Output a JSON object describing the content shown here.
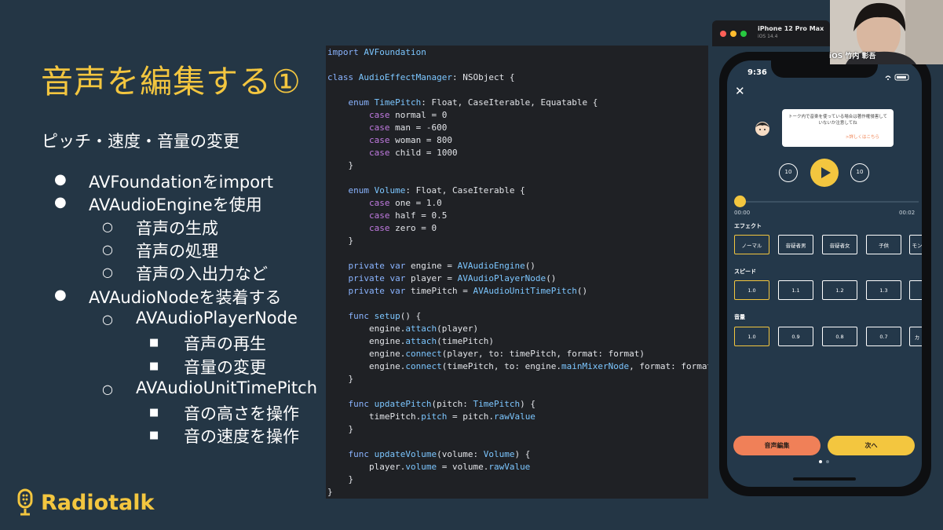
{
  "slide": {
    "title": "音声を編集する①",
    "subtitle": "ピッチ・速度・音量の変更",
    "bullets": [
      {
        "level": 1,
        "text": "AVFoundationをimport"
      },
      {
        "level": 1,
        "text": "AVAudioEngineを使用"
      },
      {
        "level": 2,
        "text": "音声の生成"
      },
      {
        "level": 2,
        "text": "音声の処理"
      },
      {
        "level": 2,
        "text": "音声の入出力など"
      },
      {
        "level": 1,
        "text": "AVAudioNodeを装着する"
      },
      {
        "level": 2,
        "text": "AVAudioPlayerNode"
      },
      {
        "level": 3,
        "text": "音声の再生"
      },
      {
        "level": 3,
        "text": "音量の変更"
      },
      {
        "level": 2,
        "text": "AVAudioUnitTimePitch"
      },
      {
        "level": 3,
        "text": "音の高さを操作"
      },
      {
        "level": 3,
        "text": "音の速度を操作"
      }
    ],
    "bullet_markers": {
      "level1": "●",
      "level2": "○",
      "level3": "■"
    },
    "logo_text": "Radiotalk"
  },
  "code": {
    "lines": [
      "import AVFoundation",
      "",
      "class AudioEffectManager: NSObject {",
      "",
      "    enum TimePitch: Float, CaseIterable, Equatable {",
      "        case normal = 0",
      "        case man = -600",
      "        case woman = 800",
      "        case child = 1000",
      "    }",
      "",
      "    enum Volume: Float, CaseIterable {",
      "        case one = 1.0",
      "        case half = 0.5",
      "        case zero = 0",
      "    }",
      "",
      "    private var engine = AVAudioEngine()",
      "    private var player = AVAudioPlayerNode()",
      "    private var timePitch = AVAudioUnitTimePitch()",
      "",
      "    func setup() {",
      "        engine.attach(player)",
      "        engine.attach(timePitch)",
      "        engine.connect(player, to: timePitch, format: format)",
      "        engine.connect(timePitch, to: engine.mainMixerNode, format: format)",
      "    }",
      "",
      "    func updatePitch(pitch: TimePitch) {",
      "        timePitch.pitch = pitch.rawValue",
      "    }",
      "",
      "    func updateVolume(volume: Volume) {",
      "        player.volume = volume.rawValue",
      "    }",
      "}"
    ]
  },
  "simulator": {
    "device": "iPhone 12 Pro Max",
    "os": "iOS 14.4",
    "status_time": "9:36"
  },
  "app": {
    "close_icon": "close-icon",
    "bubble_text": "トーク内で音楽を使っている場合は著作権侵害していないか注意してね",
    "bubble_link": ">詳しくはこちら",
    "skip_back": "10",
    "skip_forward": "10",
    "time_start": "00:00",
    "time_end": "00:02",
    "effect_label": "エフェクト",
    "effects": [
      {
        "label": "ノーマル",
        "selected": true
      },
      {
        "label": "音疑者男",
        "selected": false
      },
      {
        "label": "音疑者女",
        "selected": false
      },
      {
        "label": "子供",
        "selected": false
      },
      {
        "label": "モン",
        "selected": false
      }
    ],
    "speed_label": "スピード",
    "speeds": [
      {
        "label": "1.0",
        "selected": true
      },
      {
        "label": "1.1",
        "selected": false
      },
      {
        "label": "1.2",
        "selected": false
      },
      {
        "label": "1.3",
        "selected": false
      },
      {
        "label": "",
        "selected": false
      }
    ],
    "volume_label": "音量",
    "volumes": [
      {
        "label": "1.0",
        "selected": true
      },
      {
        "label": "0.9",
        "selected": false
      },
      {
        "label": "0.8",
        "selected": false
      },
      {
        "label": "0.7",
        "selected": false
      },
      {
        "label": "カ",
        "selected": false
      }
    ],
    "edit_button": "音声編集",
    "next_button": "次へ",
    "page_count": 2,
    "current_page": 1
  },
  "webcam": {
    "name": "iOS 竹内 彰吾"
  },
  "colors": {
    "accent": "#f3c63f",
    "background": "#243645",
    "code_bg": "#1f2125",
    "keyword": "#8ab4ff",
    "orange": "#f08058"
  }
}
